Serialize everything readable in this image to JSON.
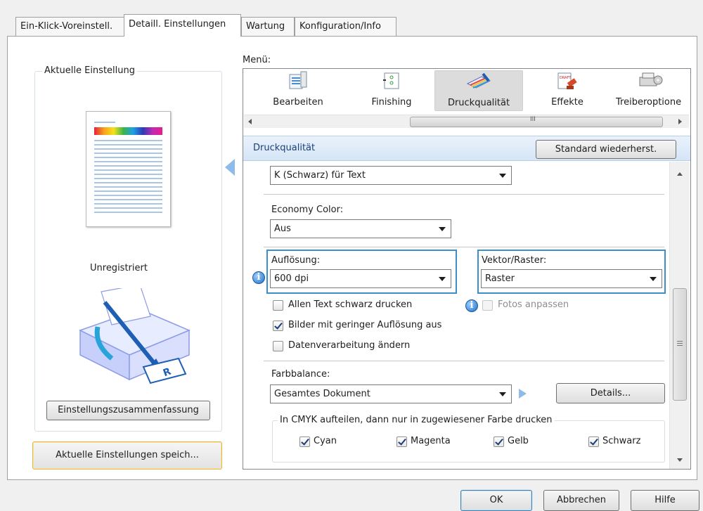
{
  "tabs": [
    {
      "label": "Ein-Klick-Voreinstell."
    },
    {
      "label": "Detaill. Einstellungen"
    },
    {
      "label": "Wartung"
    },
    {
      "label": "Konfiguration/Info"
    }
  ],
  "left": {
    "group_title": "Aktuelle Einstellung",
    "status": "Unregistriert",
    "summary_button": "Einstellungszusammenfassung",
    "save_button": "Aktuelle Einstellungen speich..."
  },
  "menu": {
    "label": "Menü:",
    "items": [
      {
        "label": "Bearbeiten",
        "icon": "edit-icon"
      },
      {
        "label": "Finishing",
        "icon": "finishing-icon"
      },
      {
        "label": "Druckqualität",
        "icon": "print-quality-icon"
      },
      {
        "label": "Effekte",
        "icon": "effects-icon"
      },
      {
        "label": "Treiberoptione",
        "icon": "driver-options-icon"
      }
    ],
    "scroll_grip": "III"
  },
  "section": {
    "title": "Druckqualität",
    "reset_button": "Standard wiederherst."
  },
  "settings": {
    "text_mode": "K (Schwarz) für Text",
    "economy_label": "Economy Color:",
    "economy_value": "Aus",
    "resolution_label": "Auflösung:",
    "resolution_value": "600 dpi",
    "vector_label": "Vektor/Raster:",
    "vector_value": "Raster",
    "cb_all_text_black": "Allen Text schwarz drucken",
    "cb_photos": "Fotos anpassen",
    "cb_low_res": "Bilder mit geringer Auflösung aus",
    "cb_processing": "Datenverarbeitung ändern",
    "color_balance_label": "Farbbalance:",
    "color_balance_value": "Gesamtes Dokument",
    "details_button": "Details...",
    "cmyk_group": "In CMYK aufteilen, dann nur in zugewiesener Farbe drucken",
    "cmyk": [
      {
        "label": "Cyan",
        "checked": true
      },
      {
        "label": "Magenta",
        "checked": true
      },
      {
        "label": "Gelb",
        "checked": true
      },
      {
        "label": "Schwarz",
        "checked": true
      }
    ]
  },
  "footer": {
    "ok": "OK",
    "cancel": "Abbrechen",
    "help": "Hilfe"
  }
}
